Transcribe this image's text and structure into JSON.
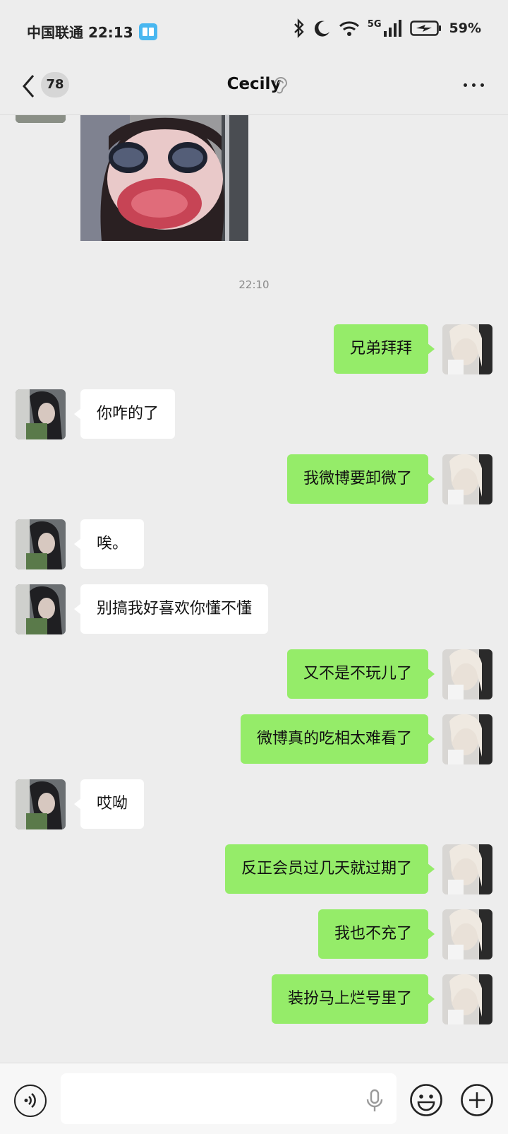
{
  "status_bar": {
    "carrier_time": "中国联通 22:13",
    "network": "5G",
    "battery": "59%"
  },
  "header": {
    "unread_count": "78",
    "contact_name": "Cecily"
  },
  "chat": {
    "timestamp": "22:10",
    "messages": [
      {
        "from": "me",
        "text": "兄弟拜拜"
      },
      {
        "from": "her",
        "text": "你咋的了"
      },
      {
        "from": "me",
        "text": "我微博要卸微了"
      },
      {
        "from": "her",
        "text": "唉。"
      },
      {
        "from": "her",
        "text": "别搞我好喜欢你懂不懂"
      },
      {
        "from": "me",
        "text": "又不是不玩儿了"
      },
      {
        "from": "me",
        "text": "微博真的吃相太难看了"
      },
      {
        "from": "her",
        "text": "哎呦"
      },
      {
        "from": "me",
        "text": "反正会员过几天就过期了"
      },
      {
        "from": "me",
        "text": "我也不充了"
      },
      {
        "from": "me",
        "text": "装扮马上烂号里了"
      }
    ]
  },
  "colors": {
    "my_bubble": "#95ec69",
    "her_bubble": "#ffffff",
    "background": "#ededed"
  },
  "icons": {
    "back": "chevron-left-icon",
    "ear": "ear-icon",
    "more": "more-dots-icon",
    "voice": "voice-mode-icon",
    "mic": "microphone-icon",
    "emoji": "emoji-icon",
    "plus": "plus-icon"
  }
}
